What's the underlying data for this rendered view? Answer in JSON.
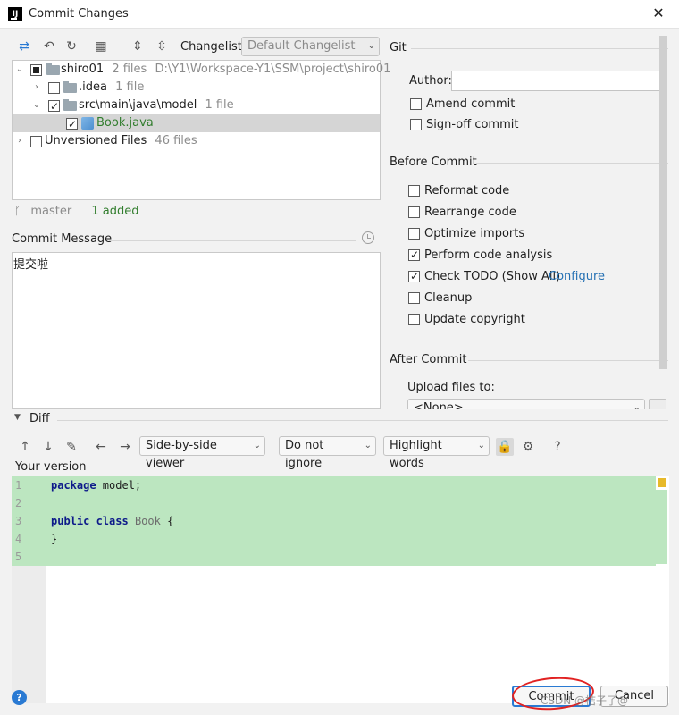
{
  "window": {
    "title": "Commit Changes",
    "close_label": "✕"
  },
  "toolbar": {
    "changelist_label": "Changelist:",
    "changelist_value": "Default Changelist"
  },
  "tree": {
    "root": {
      "name": "shiro01",
      "count": "2 files",
      "path": "D:\\Y1\\Workspace-Y1\\SSM\\project\\shiro01"
    },
    "idea": {
      "name": ".idea",
      "count": "1 file"
    },
    "model": {
      "name": "src\\main\\java\\model",
      "count": "1 file"
    },
    "book": {
      "name": "Book.java"
    },
    "unversioned": {
      "name": "Unversioned Files",
      "count": "46 files"
    }
  },
  "status": {
    "branch": "master",
    "added": "1 added"
  },
  "commit_message": {
    "label": "Commit Message",
    "value": "提交啦"
  },
  "git": {
    "header": "Git",
    "author_label": "Author:",
    "author_value": "",
    "amend": "Amend commit",
    "signoff": "Sign-off commit"
  },
  "before_commit": {
    "header": "Before Commit",
    "reformat": "Reformat code",
    "rearrange": "Rearrange code",
    "optimize": "Optimize imports",
    "analysis": "Perform code analysis",
    "todo": "Check TODO (Show All)",
    "configure": "Configure",
    "cleanup": "Cleanup",
    "copyright": "Update copyright"
  },
  "after_commit": {
    "header": "After Commit",
    "upload_label": "Upload files to:",
    "upload_value": "<None>"
  },
  "diff": {
    "header": "Diff",
    "viewer": "Side-by-side viewer",
    "ignore": "Do not ignore",
    "highlight": "Highlight words",
    "your_version": "Your version",
    "lines": [
      {
        "n": "1",
        "kw": "package",
        "rest": " model;"
      },
      {
        "n": "2",
        "kw": "",
        "rest": ""
      },
      {
        "n": "3",
        "kw": "public class",
        "cls": "Book",
        "rest": " {"
      },
      {
        "n": "4",
        "kw": "",
        "rest": "}"
      },
      {
        "n": "5",
        "kw": "",
        "rest": ""
      }
    ]
  },
  "footer": {
    "commit": "Commit",
    "cancel": "Cancel",
    "help": "?"
  },
  "watermark": "CSDN @桔子了@"
}
